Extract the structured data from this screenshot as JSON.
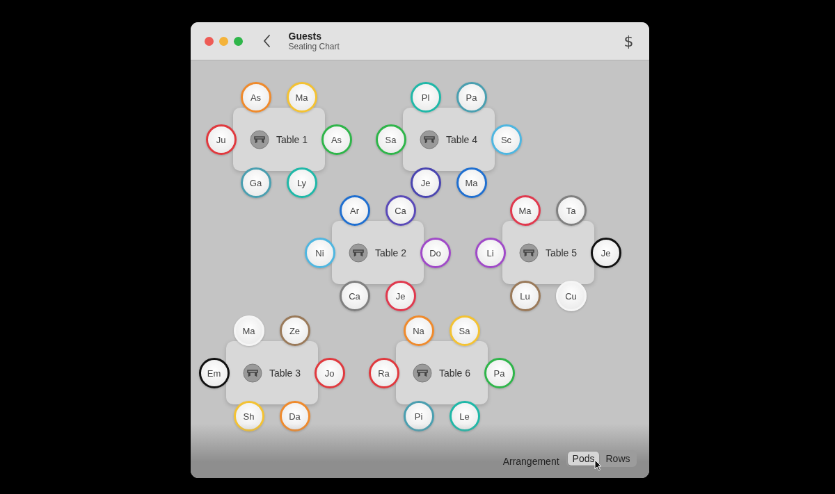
{
  "window": {
    "title": "Guests",
    "subtitle": "Seating Chart",
    "toolbar_symbol": "$"
  },
  "tables": [
    {
      "label": "Table 1",
      "seats": [
        {
          "initials": "As",
          "color": "#ef8a2c"
        },
        {
          "initials": "Ma",
          "color": "#f3c233"
        },
        {
          "initials": "Ju",
          "color": "#e0393e"
        },
        {
          "initials": "As",
          "color": "#2fb54a"
        },
        {
          "initials": "Ga",
          "color": "#4a9fb0"
        },
        {
          "initials": "Ly",
          "color": "#1fb8a8"
        }
      ]
    },
    {
      "label": "Table 4",
      "seats": [
        {
          "initials": "Pl",
          "color": "#1fb8a8"
        },
        {
          "initials": "Pa",
          "color": "#4a9fb0"
        },
        {
          "initials": "Sa",
          "color": "#2fb54a"
        },
        {
          "initials": "Sc",
          "color": "#4fb6e0"
        },
        {
          "initials": "Je",
          "color": "#4a45b0"
        },
        {
          "initials": "Ma",
          "color": "#1f6fd0"
        }
      ]
    },
    {
      "label": "Table 2",
      "seats": [
        {
          "initials": "Ar",
          "color": "#1f6fd0"
        },
        {
          "initials": "Ca",
          "color": "#5a4ab8"
        },
        {
          "initials": "Ni",
          "color": "#4fb6e0"
        },
        {
          "initials": "Do",
          "color": "#a04ac8"
        },
        {
          "initials": "Ca",
          "color": "#808080"
        },
        {
          "initials": "Je",
          "color": "#e0394e"
        }
      ]
    },
    {
      "label": "Table 5",
      "seats": [
        {
          "initials": "Ma",
          "color": "#e0394e"
        },
        {
          "initials": "Ta",
          "color": "#808080"
        },
        {
          "initials": "Li",
          "color": "#a04ac8"
        },
        {
          "initials": "Je",
          "color": "#111111"
        },
        {
          "initials": "Lu",
          "color": "#9a7a5a"
        },
        {
          "initials": "Cu",
          "color": "#f5f5f5"
        }
      ]
    },
    {
      "label": "Table 3",
      "seats": [
        {
          "initials": "Ma",
          "color": "#f5f5f5"
        },
        {
          "initials": "Ze",
          "color": "#9a7a5a"
        },
        {
          "initials": "Em",
          "color": "#111111"
        },
        {
          "initials": "Jo",
          "color": "#e0393e"
        },
        {
          "initials": "Sh",
          "color": "#f3c233"
        },
        {
          "initials": "Da",
          "color": "#ef8a2c"
        }
      ]
    },
    {
      "label": "Table 6",
      "seats": [
        {
          "initials": "Na",
          "color": "#ef8a2c"
        },
        {
          "initials": "Sa",
          "color": "#f3c233"
        },
        {
          "initials": "Ra",
          "color": "#e0393e"
        },
        {
          "initials": "Pa",
          "color": "#2fb54a"
        },
        {
          "initials": "Pi",
          "color": "#4a9fb0"
        },
        {
          "initials": "Le",
          "color": "#1fb8a8"
        }
      ]
    }
  ],
  "arrangement": {
    "label": "Arrangement",
    "options": [
      {
        "label": "Pods",
        "selected": true
      },
      {
        "label": "Rows",
        "selected": false
      }
    ]
  }
}
